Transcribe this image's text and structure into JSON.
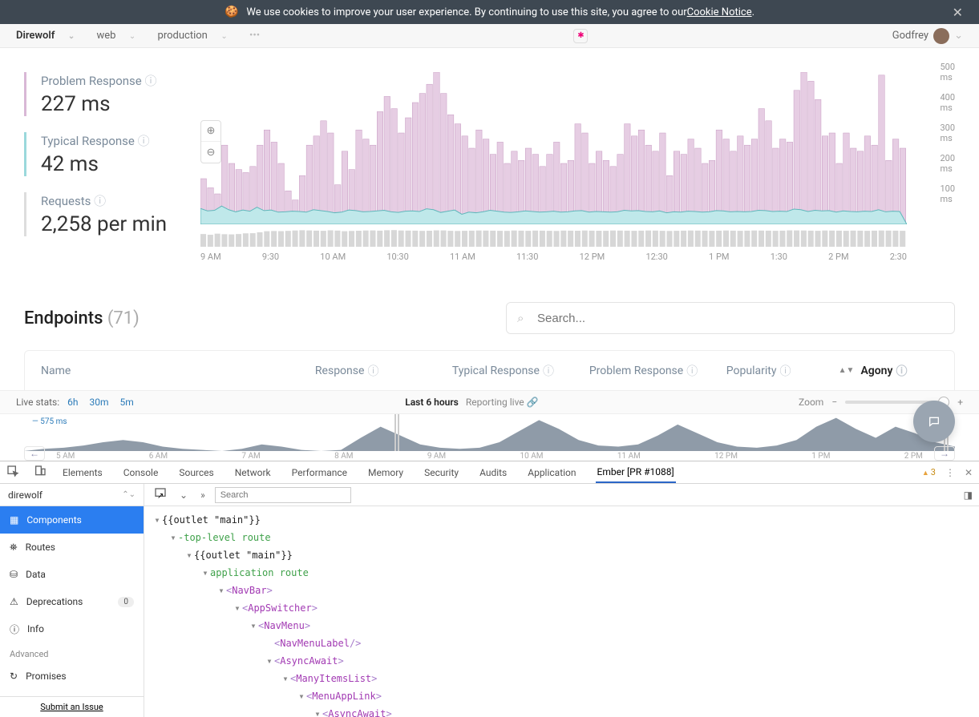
{
  "cookie_banner": {
    "text_a": "We use cookies to improve your user experience. By continuing to use this site, you agree to our ",
    "link_text": "Cookie Notice",
    "text_b": "."
  },
  "header": {
    "app": "Direwolf",
    "env1": "web",
    "env2": "production",
    "user": "Godfrey"
  },
  "metrics": {
    "problem": {
      "label": "Problem Response",
      "value": "227 ms"
    },
    "typical": {
      "label": "Typical Response",
      "value": "42 ms"
    },
    "requests": {
      "label": "Requests",
      "value": "2,258 per min"
    }
  },
  "chart_data": {
    "type": "area",
    "title": "",
    "xlabel": "",
    "ylabel": "ms",
    "ylim": [
      0,
      500
    ],
    "yticks": [
      "500 ms",
      "400 ms",
      "300 ms",
      "200 ms",
      "100 ms"
    ],
    "xticks": [
      "9 AM",
      "9:30",
      "10 AM",
      "10:30",
      "11 AM",
      "11:30",
      "12 PM",
      "12:30",
      "1 PM",
      "1:30",
      "2 PM",
      "2:30"
    ],
    "series": [
      {
        "name": "Problem Response",
        "color": "#d9b8d6",
        "values": [
          150,
          120,
          100,
          260,
          200,
          180,
          170,
          190,
          260,
          310,
          270,
          200,
          110,
          80,
          160,
          260,
          290,
          340,
          300,
          130,
          240,
          180,
          310,
          280,
          260,
          370,
          420,
          380,
          300,
          350,
          400,
          430,
          460,
          500,
          430,
          360,
          330,
          290,
          250,
          310,
          280,
          230,
          270,
          200,
          240,
          210,
          250,
          230,
          190,
          230,
          270,
          200,
          210,
          330,
          300,
          200,
          240,
          210,
          190,
          230,
          330,
          290,
          310,
          260,
          240,
          300,
          160,
          240,
          230,
          280,
          250,
          200,
          210,
          310,
          280,
          240,
          290,
          260,
          280,
          380,
          340,
          250,
          280,
          270,
          440,
          500,
          470,
          410,
          290,
          300,
          200,
          300,
          250,
          240,
          290,
          260,
          490,
          210,
          280,
          250
        ]
      },
      {
        "name": "Typical Response",
        "color": "#9bd9dc",
        "values": [
          52,
          44,
          46,
          60,
          48,
          41,
          47,
          43,
          56,
          45,
          47,
          40,
          41,
          43,
          42,
          40,
          48,
          45,
          42,
          38,
          40,
          47,
          45,
          41,
          42,
          44,
          46,
          41,
          39,
          43,
          44,
          42,
          51,
          48,
          39,
          43,
          47,
          33,
          40,
          38,
          41,
          46,
          43,
          40,
          39,
          41,
          44,
          42,
          40,
          41,
          43,
          40,
          41,
          44,
          45,
          40,
          42,
          41,
          40,
          41,
          46,
          44,
          45,
          42,
          41,
          44,
          38,
          41,
          40,
          43,
          42,
          40,
          41,
          45,
          44,
          41,
          42,
          41,
          42,
          46,
          45,
          42,
          43,
          42,
          50,
          48,
          42,
          46,
          44,
          45,
          40,
          44,
          42,
          41,
          43,
          42,
          48,
          41,
          43,
          42
        ]
      }
    ],
    "requests_mini": [
      1800,
      1700,
      1850,
      1780,
      1750,
      1800,
      1900,
      1920,
      2050,
      2200,
      2230,
      2210,
      2250,
      2300,
      2340,
      2310,
      2280,
      2260,
      2330,
      2290,
      2200,
      2240,
      2270,
      2300,
      2310,
      2280,
      2340,
      2360,
      2300,
      2290,
      2280,
      2250,
      2270,
      2320,
      2310,
      2260,
      2240,
      2260,
      2280,
      2300,
      2290,
      2280,
      2260,
      2250,
      2300,
      2280,
      2260,
      2290,
      2280,
      2260,
      2240,
      2290,
      2280,
      2270,
      2300,
      2280,
      2270,
      2260,
      2300,
      2290,
      2280,
      2260,
      2280,
      2300,
      2290,
      2260,
      2240,
      2260,
      2280,
      2300,
      2290,
      2280,
      2260,
      2280,
      2300,
      2280,
      2260,
      2280,
      2300,
      2290,
      2280,
      2260,
      2280,
      2320,
      2310,
      2300,
      2280,
      2260,
      2300,
      2290,
      2280,
      2260,
      2290,
      2280,
      2260,
      2280,
      2300,
      2290,
      2280,
      2260
    ]
  },
  "endpoints": {
    "title": "Endpoints",
    "count": "(71)",
    "search_placeholder": "Search...",
    "columns": {
      "name": "Name",
      "response": "Response",
      "typical": "Typical Response",
      "problem": "Problem Response",
      "popularity": "Popularity",
      "agony": "Agony"
    }
  },
  "live_bar": {
    "label": "Live stats:",
    "ranges": [
      "6h",
      "30m",
      "5m"
    ],
    "center_strong": "Last 6 hours",
    "center_sub": "Reporting live",
    "zoom_label": "Zoom",
    "overview_y": "575 ms",
    "overview_x": [
      "5 AM",
      "6 AM",
      "7 AM",
      "8 AM",
      "9 AM",
      "10 AM",
      "11 AM",
      "12 PM",
      "1 PM",
      "2 PM"
    ]
  },
  "devtools": {
    "tabs": [
      "Elements",
      "Console",
      "Sources",
      "Network",
      "Performance",
      "Memory",
      "Security",
      "Audits",
      "Application",
      "Ember [PR #1088]"
    ],
    "active_tab": "Ember [PR #1088]",
    "warn_count": "3",
    "app_name": "direwolf",
    "nav": [
      {
        "label": "Components",
        "active": true
      },
      {
        "label": "Routes"
      },
      {
        "label": "Data"
      },
      {
        "label": "Deprecations",
        "badge": "0"
      },
      {
        "label": "Info"
      }
    ],
    "nav_section": "Advanced",
    "nav_more": [
      {
        "label": "Promises"
      }
    ],
    "footer_link": "Submit an Issue",
    "search_placeholder": "Search",
    "tree": [
      {
        "indent": 0,
        "type": "plain",
        "text": "{{outlet \"main\"}}"
      },
      {
        "indent": 1,
        "type": "green",
        "text": "-top-level route"
      },
      {
        "indent": 2,
        "type": "plain",
        "text": "{{outlet \"main\"}}"
      },
      {
        "indent": 3,
        "type": "green",
        "text": "application route"
      },
      {
        "indent": 4,
        "type": "comp",
        "text": "NavBar"
      },
      {
        "indent": 5,
        "type": "comp",
        "text": "AppSwitcher"
      },
      {
        "indent": 6,
        "type": "comp",
        "text": "NavMenu"
      },
      {
        "indent": 7,
        "type": "comp-self",
        "text": "NavMenuLabel"
      },
      {
        "indent": 7,
        "type": "comp",
        "text": "AsyncAwait"
      },
      {
        "indent": 8,
        "type": "comp",
        "text": "ManyItemsList"
      },
      {
        "indent": 9,
        "type": "comp",
        "text": "MenuAppLink"
      },
      {
        "indent": 10,
        "type": "comp",
        "text": "AsyncAwait"
      }
    ]
  }
}
